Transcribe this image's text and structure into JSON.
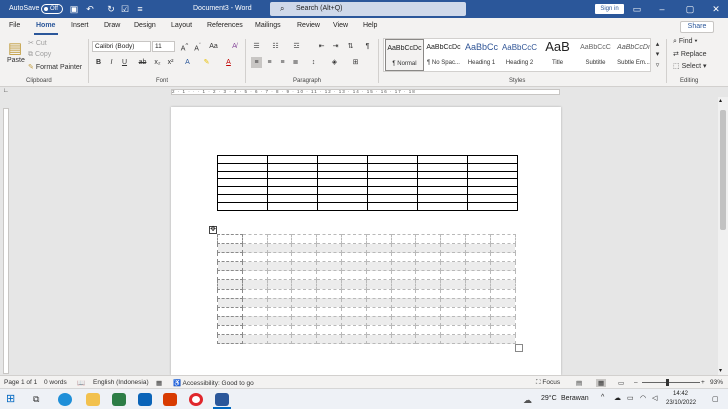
{
  "titlebar": {
    "autosave_label": "AutoSave",
    "autosave_state": "Off",
    "doc_title": "Document3 - Word",
    "search_placeholder": "Search (Alt+Q)",
    "signin_label": "Sign in"
  },
  "tabs": [
    "File",
    "Home",
    "Insert",
    "Draw",
    "Design",
    "Layout",
    "References",
    "Mailings",
    "Review",
    "View",
    "Help"
  ],
  "active_tab": "Home",
  "share_label": "Share",
  "ribbon": {
    "clipboard": {
      "paste": "Paste",
      "cut": "Cut",
      "copy": "Copy",
      "format_painter": "Format Painter",
      "group_label": "Clipboard"
    },
    "font": {
      "font_name": "Calibri (Body)",
      "font_size": "11",
      "group_label": "Font"
    },
    "paragraph": {
      "group_label": "Paragraph"
    },
    "styles": {
      "group_label": "Styles",
      "items": [
        {
          "preview": "AaBbCcDc",
          "name": "¶ Normal"
        },
        {
          "preview": "AaBbCcDc",
          "name": "¶ No Spac..."
        },
        {
          "preview": "AaBbCc",
          "name": "Heading 1"
        },
        {
          "preview": "AaBbCcC",
          "name": "Heading 2"
        },
        {
          "preview": "AaB",
          "name": "Title"
        },
        {
          "preview": "AaBbCcC",
          "name": "Subtitle"
        },
        {
          "preview": "AaBbCcDı",
          "name": "Subtle Em..."
        }
      ]
    },
    "editing": {
      "find": "Find",
      "replace": "Replace",
      "select": "Select",
      "group_label": "Editing"
    }
  },
  "ruler_text": "2 · 1 · · · 1 · 2 · 3 · 4 · 5 · 6 · 7 · 8 · 9 · 10 · 11 · 12 · 13 · 14 · 15 · 16 · 17 · 18",
  "status": {
    "page": "Page 1 of 1",
    "words": "0 words",
    "language": "English (Indonesia)",
    "accessibility": "Accessibility: Good to go",
    "focus": "Focus",
    "zoom": "93%"
  },
  "taskbar": {
    "weather": "29°C",
    "weather_desc": "Berawan",
    "time": "14:42",
    "date": "23/10/2022"
  },
  "colors": {
    "accent": "#2b579a",
    "ribbon_bg": "#f3f2f1"
  }
}
